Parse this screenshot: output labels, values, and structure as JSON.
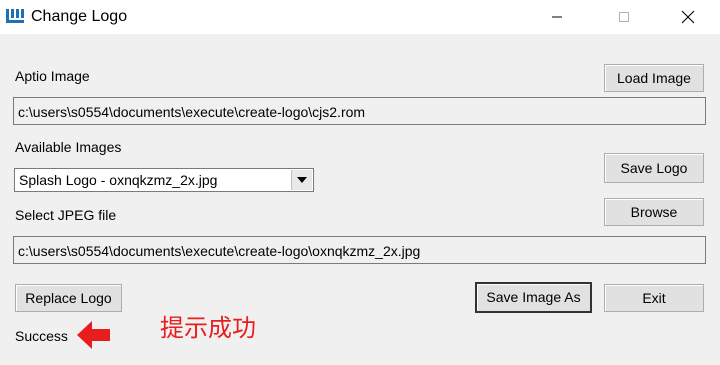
{
  "window": {
    "title": "Change Logo",
    "controls": {
      "minimize_icon": "minimize-icon",
      "maximize_icon": "maximize-icon",
      "close_icon": "close-icon"
    }
  },
  "aptio": {
    "label": "Aptio Image",
    "path": "c:\\users\\s0554\\documents\\execute\\create-logo\\cjs2.rom",
    "load_button": "Load Image"
  },
  "images": {
    "label": "Available Images",
    "selected": "Splash Logo - oxnqkzmz_2x.jpg",
    "save_logo_button": "Save Logo"
  },
  "jpeg": {
    "label": "Select JPEG file",
    "path": "c:\\users\\s0554\\documents\\execute\\create-logo\\oxnqkzmz_2x.jpg",
    "browse_button": "Browse"
  },
  "actions": {
    "replace_button": "Replace Logo",
    "save_as_button": "Save Image As",
    "exit_button": "Exit"
  },
  "status": {
    "text": "Success",
    "annotation": "提示成功",
    "annotation_color": "#e81e1e"
  },
  "colors": {
    "window_bg": "#f0f0f0",
    "titlebar_bg": "#ffffff",
    "button_bg": "#e1e1e1"
  }
}
